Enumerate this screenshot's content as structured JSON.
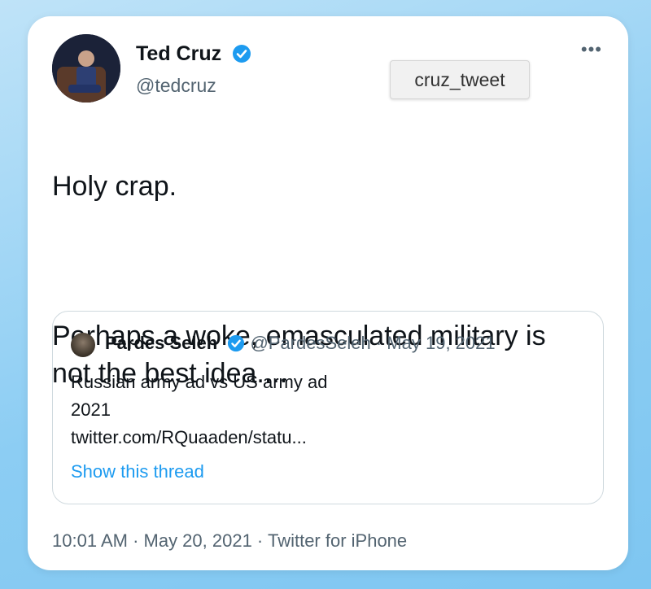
{
  "tweet": {
    "display_name": "Ted Cruz",
    "handle": "@tedcruz",
    "more_icon": "•••",
    "text_line1": "Holy crap.",
    "text_line2": "Perhaps a woke, emasculated military is not the best idea....",
    "footer": "10:01 AM · May 20, 2021 · Twitter for iPhone"
  },
  "label_chip": "cruz_tweet",
  "quoted": {
    "display_name": "Pardes Seleh",
    "meta": "@PardesSeleh · May 19, 2021",
    "line1": "Russian army ad vs US army ad",
    "line2": "2021",
    "line3": "twitter.com/RQuaaden/statu...",
    "show_thread": "Show this thread"
  },
  "colors": {
    "accent": "#1d9bf0",
    "text": "#0f1419",
    "muted": "#536471"
  }
}
